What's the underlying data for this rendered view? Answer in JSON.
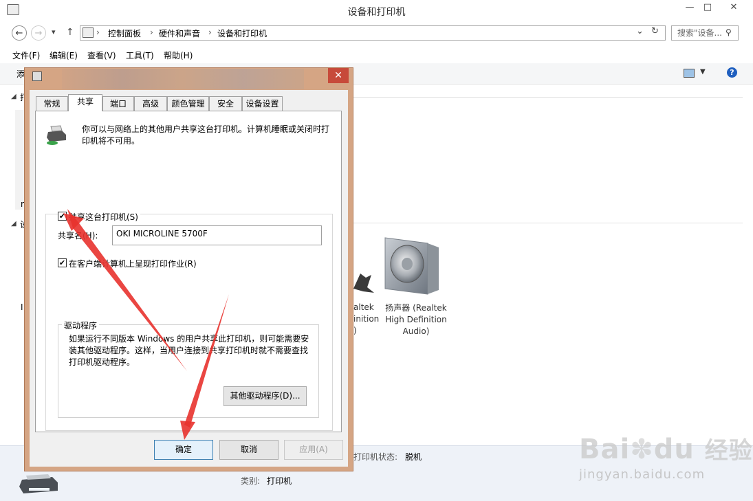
{
  "window": {
    "title": "设备和打印机",
    "minimize": "—",
    "maximize": "□",
    "close": "✕"
  },
  "nav": {
    "back": "←",
    "forward": "→",
    "recent": "▾",
    "up": "↑",
    "breadcrumb": [
      "控制面板",
      "硬件和声音",
      "设备和打印机"
    ],
    "search_placeholder": "搜索\"设备...",
    "refresh": "↻",
    "dropdown": "⌄"
  },
  "menu": [
    "文件(F)",
    "编辑(E)",
    "查看(V)",
    "工具(T)",
    "帮助(H)"
  ],
  "background": {
    "cmd_partial": "添",
    "section1_partial": "打",
    "section2_partial": "设",
    "partial_char_n": "n",
    "partial_char_l": "I",
    "device_partial_line1": "altek",
    "device_partial_line2": "inition",
    "device_partial_line3": ")",
    "speaker_label": [
      "扬声器 (Realtek",
      "High Definition",
      "Audio)"
    ],
    "status_label": "打印机状态:",
    "status_value": "脱机",
    "category_label": "类别:",
    "category_value": "打印机"
  },
  "dialog": {
    "close": "✕",
    "tabs": [
      "常规",
      "共享",
      "端口",
      "高级",
      "颜色管理",
      "安全",
      "设备设置"
    ],
    "active_tab": 1,
    "description": [
      "你可以与网络上的其他用户共享这台打印机。计算机睡眠或关闭时打",
      "印机将不可用。"
    ],
    "share_checkbox_label": "共享这台打印机(S)",
    "share_name_label": "共享名(H):",
    "share_name_value": "OKI MICROLINE 5700F",
    "render_jobs_label": "在客户端计算机上呈现打印作业(R)",
    "drivers_group_title": "驱动程序",
    "drivers_text": [
      "如果运行不同版本 Windows 的用户共享此打印机，则可能需要安",
      "装其他驱动程序。这样，当用户连接到共享打印机时就不需要查找",
      "打印机驱动程序。"
    ],
    "additional_drivers_button": "其他驱动程序(D)...",
    "ok_button": "确定",
    "cancel_button": "取消",
    "apply_button": "应用(A)"
  },
  "watermark": {
    "brand": "Bai",
    "brand2": "du",
    "suffix": "经验",
    "url": "jingyan.baidu.com"
  },
  "colors": {
    "dialog_frame": "#d5a584",
    "close_red": "#c74a3a",
    "arrow_red": "#e8322d",
    "help_blue": "#1f5fbf"
  }
}
